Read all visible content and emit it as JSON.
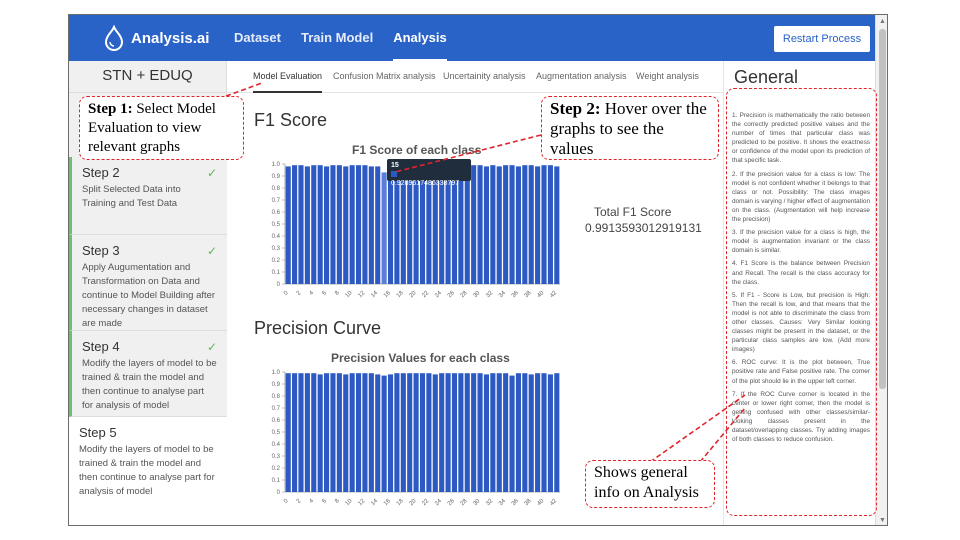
{
  "header": {
    "logo_text": "Analysis.ai",
    "nav": [
      "Dataset",
      "Train Model",
      "Analysis"
    ],
    "active_nav": 2,
    "restart_label": "Restart Process"
  },
  "sidebar": {
    "title": "STN + EDUQ",
    "steps": [
      {
        "title": "Step 2",
        "desc": "Split Selected Data into Training and Test Data",
        "done": true
      },
      {
        "title": "Step 3",
        "desc": "Apply Augumentation and Transformation on Data and continue to Model Building after necessary changes in dataset are made",
        "done": true
      },
      {
        "title": "Step 4",
        "desc": "Modify the layers of model to be trained & train the model and then continue to analyse part for analysis of model",
        "done": true
      },
      {
        "title": "Step 5",
        "desc": "Modify the layers of model to be trained & train the model and then continue to analyse part for analysis of model",
        "done": false
      }
    ]
  },
  "tabs": [
    "Model Evaluation",
    "Confusion Matrix analysis",
    "Uncertainity analysis",
    "Augmentation analysis",
    "Weight analysis"
  ],
  "f1": {
    "section_title": "F1 Score",
    "total_label": "Total F1 Score",
    "total_value": "0.9913593012919131",
    "tooltip_index": "15",
    "tooltip_value": "0.9289617486338797"
  },
  "precision": {
    "section_title": "Precision Curve"
  },
  "chart_data": [
    {
      "type": "bar",
      "title": "F1 Score of each class",
      "x": [
        0,
        1,
        2,
        3,
        4,
        5,
        6,
        7,
        8,
        9,
        10,
        11,
        12,
        13,
        14,
        15,
        16,
        17,
        18,
        19,
        20,
        21,
        22,
        23,
        24,
        25,
        26,
        27,
        28,
        29,
        30,
        31,
        32,
        33,
        34,
        35,
        36,
        37,
        38,
        39,
        40,
        41,
        42
      ],
      "values": [
        0.98,
        0.99,
        0.99,
        0.98,
        0.99,
        0.99,
        0.98,
        0.99,
        0.99,
        0.98,
        0.99,
        0.99,
        0.99,
        0.98,
        0.98,
        0.93,
        0.97,
        0.99,
        0.99,
        0.98,
        0.99,
        0.99,
        0.98,
        0.99,
        0.99,
        0.98,
        0.99,
        0.99,
        0.98,
        0.99,
        0.99,
        0.98,
        0.99,
        0.98,
        0.99,
        0.99,
        0.98,
        0.99,
        0.99,
        0.98,
        0.99,
        0.99,
        0.98
      ],
      "ylim": [
        0,
        1.0
      ],
      "yticks": [
        "0",
        "0.1",
        "0.2",
        "0.3",
        "0.4",
        "0.5",
        "0.6",
        "0.7",
        "0.8",
        "0.9",
        "1.0"
      ],
      "xticks": [
        "0",
        "2",
        "4",
        "6",
        "8",
        "10",
        "12",
        "14",
        "16",
        "18",
        "20",
        "22",
        "24",
        "26",
        "28",
        "30",
        "32",
        "34",
        "36",
        "38",
        "40",
        "42"
      ]
    },
    {
      "type": "bar",
      "title": "Precision Values for each class",
      "x": [
        0,
        1,
        2,
        3,
        4,
        5,
        6,
        7,
        8,
        9,
        10,
        11,
        12,
        13,
        14,
        15,
        16,
        17,
        18,
        19,
        20,
        21,
        22,
        23,
        24,
        25,
        26,
        27,
        28,
        29,
        30,
        31,
        32,
        33,
        34,
        35,
        36,
        37,
        38,
        39,
        40,
        41,
        42
      ],
      "values": [
        0.99,
        0.99,
        0.99,
        0.99,
        0.99,
        0.98,
        0.99,
        0.99,
        0.99,
        0.98,
        0.99,
        0.99,
        0.99,
        0.99,
        0.98,
        0.97,
        0.98,
        0.99,
        0.99,
        0.99,
        0.99,
        0.99,
        0.99,
        0.98,
        0.99,
        0.99,
        0.99,
        0.99,
        0.99,
        0.99,
        0.99,
        0.98,
        0.99,
        0.99,
        0.99,
        0.97,
        0.99,
        0.99,
        0.98,
        0.99,
        0.99,
        0.98,
        0.99
      ],
      "ylim": [
        0,
        1.0
      ],
      "yticks": [
        "0",
        "0.1",
        "0.2",
        "0.3",
        "0.4",
        "0.5",
        "0.6",
        "0.7",
        "0.8",
        "0.9",
        "1.0"
      ],
      "xticks": [
        "0",
        "2",
        "4",
        "6",
        "8",
        "10",
        "12",
        "14",
        "16",
        "18",
        "20",
        "22",
        "24",
        "26",
        "28",
        "30",
        "32",
        "34",
        "36",
        "38",
        "40",
        "42"
      ]
    }
  ],
  "right_panel": {
    "title": "General",
    "items": [
      "1. Precision is mathematically the ratio between the correctly predicted positive values and the number of times that particular class was predicted to be positive. It shows the exactness or confidence of the model upon its prediction of that specific task.",
      "2. If the precision value for a class is low: The model is not confident whether it belongs to that class or not. Possibility: The class images domain is varying / higher effect of augmentation on the class. (Augmentation will help increase the precision)",
      "3. If the precision value for a class is high, the model is augmentation invariant or the class domain is similar.",
      "4. F1 Score is the balance between Precision and Recall. The recall is the class accuracy for the class.",
      "5. If F1 - Score is Low, but precision is High: Then the recall is low, and that means that the model is not able to discriminate the class from other classes. Causes: Very Similar looking classes might be present in the dataset, or the particular class samples are low. (Add more images)",
      "6. ROC curve: It is the plot between, True positive rate and False positive rate. The corner of the plot should lie in the upper left corner.",
      "7. If the ROC Curve corner is located in the center or lower right corner, then the model is getting confused with other classes/similar-looking classes present in the dataset/overlapping classes. Try adding images of both classes to reduce confusion."
    ]
  },
  "callouts": {
    "step1_bold": "Step 1:",
    "step1_text": " Select Model Evaluation to view relevant graphs",
    "step2_bold": "Step 2:",
    "step2_text": " Hover over the graphs to see the values",
    "general_text": "Shows general info on Analysis"
  },
  "colors": {
    "header": "#2a63c8",
    "bar": "#2d59c3",
    "callout": "#e0242c",
    "check": "#5cb85c"
  }
}
